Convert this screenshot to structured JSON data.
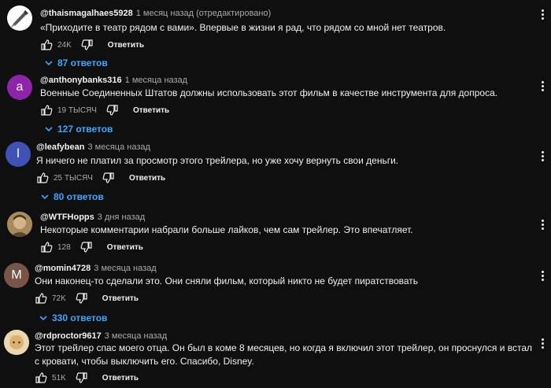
{
  "comments": [
    {
      "author": "@thaismagalhaes5928",
      "time": "1 месяц назад (отредактировано)",
      "text": "«Приходите в театр рядом с вами». Впервые в жизни я рад, что рядом со мной нет театров.",
      "likes": "24K",
      "reply_label": "Ответить",
      "replies": "87 ответов",
      "avatar_letter": "",
      "avatar_color": "#ffffff"
    },
    {
      "author": "@anthonybanks316",
      "time": "1 месяца назад",
      "text": "Военные Соединенных Штатов должны использовать этот фильм в качестве инструмента для допроса.",
      "likes": "19 ТЫСЯЧ",
      "reply_label": "Ответить",
      "replies": "127 ответов",
      "avatar_letter": "a",
      "avatar_color": "#8e24aa"
    },
    {
      "author": "@leafybean",
      "time": "3 месяца назад",
      "text": "Я ничего не платил за просмотр этого трейлера, но уже хочу вернуть свои деньги.",
      "likes": "25 ТЫСЯЧ",
      "reply_label": "Ответить",
      "replies": "80 ответов",
      "avatar_letter": "l",
      "avatar_color": "#3f51b5"
    },
    {
      "author": "@WTFHopps",
      "time": "3 дня назад",
      "text": "Некоторые комментарии набрали больше лайков, чем сам трейлер. Это впечатляет.",
      "likes": "128",
      "reply_label": "Ответить",
      "replies": "",
      "avatar_letter": "",
      "avatar_color": "#8d6e4a"
    },
    {
      "author": "@momin4728",
      "time": "3 месяца назад",
      "text": "Они наконец-то сделали это. Они сняли фильм, который никто не будет пиратствовать",
      "likes": "72K",
      "reply_label": "Ответить",
      "replies": "330 ответов",
      "avatar_letter": "M",
      "avatar_color": "#795548"
    },
    {
      "author": "@rdproctor9617",
      "time": "3 месяца назад",
      "text": "Этот трейлер спас моего отца. Он был в коме 8 месяцев, но когда я включил этот трейлер, он проснулся и встал с кровати, чтобы выключить его. Спасибо, Disney.",
      "likes": "51K",
      "reply_label": "Ответить",
      "replies": "",
      "avatar_letter": "",
      "avatar_color": "#c9a15b"
    }
  ]
}
